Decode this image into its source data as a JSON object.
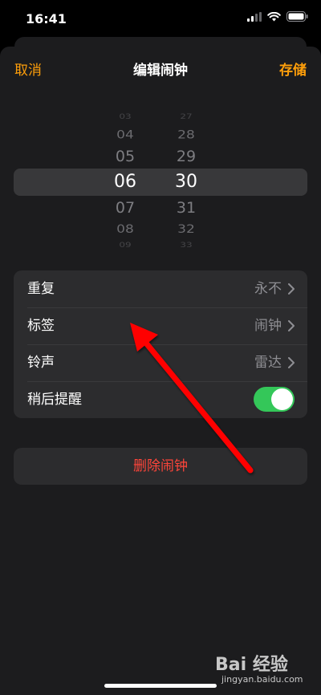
{
  "status_bar": {
    "time": "16:41"
  },
  "nav": {
    "cancel_label": "取消",
    "title": "编辑闹钟",
    "save_label": "存储"
  },
  "picker": {
    "hours": [
      "03",
      "04",
      "05",
      "06",
      "07",
      "08",
      "09"
    ],
    "minutes": [
      "27",
      "28",
      "29",
      "30",
      "31",
      "32",
      "33"
    ],
    "selected_hour": "06",
    "selected_minute": "30"
  },
  "settings": {
    "repeat": {
      "label": "重复",
      "value": "永不"
    },
    "tag": {
      "label": "标签",
      "value": "闹钟"
    },
    "sound": {
      "label": "铃声",
      "value": "雷达"
    },
    "snooze": {
      "label": "稍后提醒",
      "enabled": true
    }
  },
  "delete_label": "删除闹钟",
  "watermark": {
    "brand": "Bai 经验",
    "url": "jingyan.baidu.com"
  },
  "colors": {
    "accent": "#ff9f0a",
    "toggle_on": "#34c759",
    "destructive": "#ff453a",
    "annotation_arrow": "#ff0000"
  }
}
